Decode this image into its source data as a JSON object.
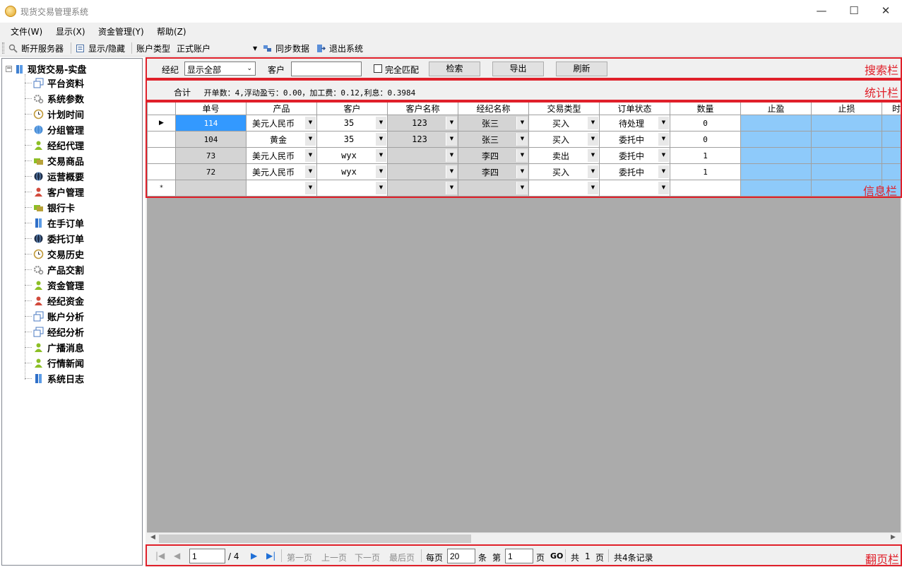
{
  "window": {
    "title": "现货交易管理系统",
    "minimize": "—",
    "maximize": "☐",
    "close": "✕"
  },
  "menu": [
    "文件(W)",
    "显示(X)",
    "资金管理(Y)",
    "帮助(Z)"
  ],
  "toolbar": {
    "disconnect": "断开服务器",
    "toggle": "显示/隐藏",
    "account_type_label": "账户类型",
    "account_type_value": "正式账户",
    "sync": "同步数据",
    "exit": "退出系统"
  },
  "tree": {
    "root": "现货交易-实盘",
    "items": [
      "平台资料",
      "系统参数",
      "计划时间",
      "分组管理",
      "经纪代理",
      "交易商品",
      "运营概要",
      "客户管理",
      "银行卡",
      "在手订单",
      "委托订单",
      "交易历史",
      "产品交割",
      "资金管理",
      "经纪资金",
      "账户分析",
      "经纪分析",
      "广播消息",
      "行情新闻",
      "系统日志"
    ],
    "icons": [
      "window-icon",
      "gear-icon",
      "clock-icon",
      "globe-icon",
      "user-green-icon",
      "cards-icon",
      "globe-dark-icon",
      "user-red-icon",
      "cards-icon",
      "book-icon",
      "globe-dark-icon",
      "clock-icon",
      "gear-icon",
      "user-green-icon",
      "user-red-icon",
      "window-icon",
      "window-icon",
      "user-green-icon",
      "user-green-icon",
      "book-icon"
    ]
  },
  "search": {
    "agent_label": "经纪",
    "agent_value": "显示全部",
    "customer_label": "客户",
    "customer_value": "",
    "exact_match": "完全匹配",
    "search_btn": "检索",
    "export_btn": "导出",
    "refresh_btn": "刷新"
  },
  "stats": {
    "label": "合计",
    "text": "开单数：4,浮动盈亏：0.00，加工费：0.12,利息：0.3984"
  },
  "grid": {
    "columns": [
      "单号",
      "产品",
      "客户",
      "客户名称",
      "经纪名称",
      "交易类型",
      "订单状态",
      "数量",
      "止盈",
      "止损",
      "时"
    ],
    "rows": [
      {
        "id": "114",
        "product": "美元人民币",
        "customer": "35",
        "customer_name": "123",
        "agent": "张三",
        "trade_type": "买入",
        "status": "待处理",
        "qty": "0"
      },
      {
        "id": "104",
        "product": "黄金",
        "customer": "35",
        "customer_name": "123",
        "agent": "张三",
        "trade_type": "买入",
        "status": "委托中",
        "qty": "0"
      },
      {
        "id": "73",
        "product": "美元人民币",
        "customer": "wyx",
        "customer_name": "",
        "agent": "李四",
        "trade_type": "卖出",
        "status": "委托中",
        "qty": "1"
      },
      {
        "id": "72",
        "product": "美元人民币",
        "customer": "wyx",
        "customer_name": "",
        "agent": "李四",
        "trade_type": "买入",
        "status": "委托中",
        "qty": "1"
      }
    ],
    "current_row_marker": "▶",
    "new_row_marker": "*"
  },
  "labels": {
    "search_bar": "搜索栏",
    "stats_bar": "统计栏",
    "info_bar": "信息栏",
    "pager_bar": "翻页栏"
  },
  "pager": {
    "page_input": "1",
    "total_pages": "/ 4",
    "first": "第一页",
    "prev": "上一页",
    "next": "下一页",
    "last": "最后页",
    "per_page_label": "每页",
    "per_page_value": "20",
    "per_page_unit": "条",
    "goto_prefix": "第",
    "goto_value": "1",
    "goto_suffix": "页",
    "go": "GO",
    "total_prefix": "共",
    "total_count": "1",
    "total_suffix": "页",
    "records": "共4条记录"
  },
  "colors": {
    "highlight": "#e0202a",
    "selection": "#3399ff",
    "stop_cols": "#8ecafa",
    "readonly": "#d4d4d4"
  }
}
